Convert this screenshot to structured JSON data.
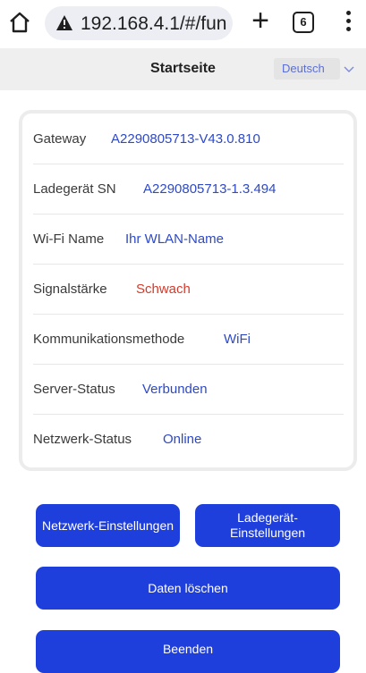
{
  "browser": {
    "url": "192.168.4.1/#/fun",
    "tab_count": "6",
    "plus_label": "+"
  },
  "header": {
    "title": "Startseite",
    "language": "Deutsch"
  },
  "info": {
    "rows": [
      {
        "label": "Gateway",
        "value": "A2290805713-V43.0.810"
      },
      {
        "label": "Ladegerät SN",
        "value": "A2290805713-1.3.494"
      },
      {
        "label": "Wi-Fi Name",
        "value": "Ihr WLAN-Name"
      },
      {
        "label": "Signalstärke",
        "value": "Schwach"
      },
      {
        "label": "Kommunikationsmethode",
        "value": "WiFi"
      },
      {
        "label": "Server-Status",
        "value": "Verbunden"
      },
      {
        "label": "Netzwerk-Status",
        "value": "Online"
      }
    ]
  },
  "buttons": {
    "network_settings": "Netzwerk-Einstellungen",
    "charger_settings": "Ladegerät-\nEinstellungen",
    "clear_data": "Daten löschen",
    "exit": "Beenden"
  },
  "colors": {
    "accent": "#1f3fdc",
    "value_text": "#2e49c6",
    "weak_signal": "#d63a2a"
  }
}
